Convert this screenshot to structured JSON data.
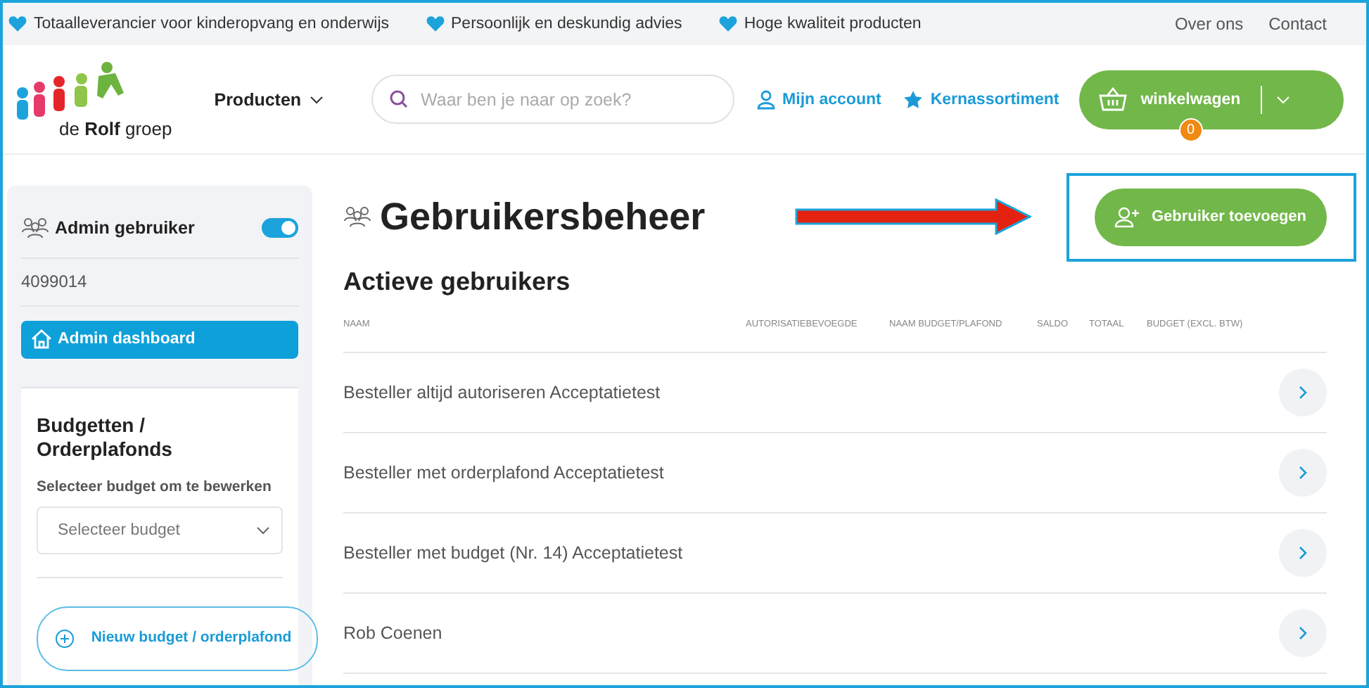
{
  "top_bar": {
    "usps": [
      "Totaalleverancier voor kinderopvang en onderwijs",
      "Persoonlijk en deskundig advies",
      "Hoge kwaliteit producten"
    ],
    "links": [
      "Over ons",
      "Contact"
    ]
  },
  "header": {
    "logo_text": "de **Rolf** groep",
    "nav": "Producten",
    "search": {
      "placeholder": "Waar ben je naar op zoek?"
    },
    "links": [
      "Mijn account",
      "Kernassortiment"
    ],
    "cart": {
      "label": "winkelwagen",
      "count": "0"
    }
  },
  "sidebar": {
    "admin": {
      "label": "Admin gebruiker",
      "on": true
    },
    "account_number": "4099014",
    "dashboard_button": "Admin dashboard",
    "budget_card": {
      "title": "Budgetten / Orderplafonds",
      "select_label": "Selecteer budget om te bewerken",
      "select": {
        "placeholder": "Selecteer budget"
      },
      "new_button": "Nieuw budget / orderplafond"
    }
  },
  "main": {
    "title": "Gebruikersbeheer",
    "add_button": "Gebruiker toevoegen",
    "section_title": "Actieve gebruikers",
    "columns": [
      "NAAM",
      "AUTORISATIEBEVOEGDE",
      "NAAM BUDGET/PLAFOND",
      "SALDO",
      "TOTAAL",
      "BUDGET (EXCL. BTW)"
    ],
    "rows": [
      {
        "name": "Besteller altijd autoriseren Acceptatietest"
      },
      {
        "name": "Besteller met orderplafond Acceptatietest"
      },
      {
        "name": "Besteller met budget (Nr. 14) Acceptatietest"
      },
      {
        "name": "Rob Coenen"
      }
    ]
  }
}
